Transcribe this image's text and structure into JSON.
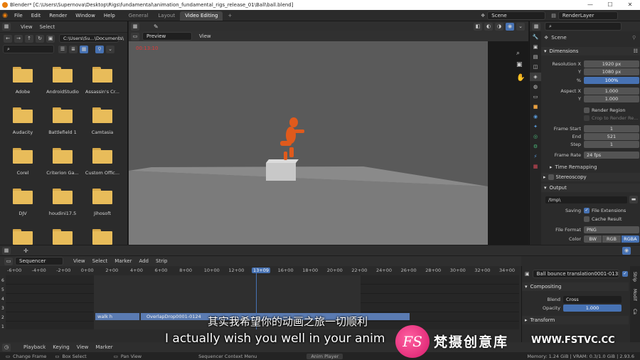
{
  "titlebar": {
    "title": "Blender* [C:\\Users\\Supernova\\Desktop\\Rigs\\fundamental\\animation_fundamental_rigs_release_01\\Ball\\ball.blend]",
    "min": "—",
    "max": "☐",
    "close": "✕"
  },
  "topmenu": {
    "items": [
      "File",
      "Edit",
      "Render",
      "Window",
      "Help"
    ],
    "workspaces": [
      "General",
      "Layout",
      "Video Editing",
      "+"
    ],
    "scene": "Scene",
    "view_layer": "RenderLayer"
  },
  "filebrowser": {
    "menu": [
      "View",
      "Select"
    ],
    "path": "C:\\Users\\Su...\\Documents\\",
    "folders": [
      "Adobe",
      "AndroidStudio",
      "Assassin's Cr...",
      "Audacity",
      "Battlefield 1",
      "Camtasia",
      "Corel",
      "Criterion Ga...",
      "Custom Offic...",
      "DJV",
      "houdini17.5",
      "Jihosoft",
      "",
      "",
      ""
    ]
  },
  "viewport": {
    "mode": "Preview",
    "menu": "View",
    "timecode": "00:13:10"
  },
  "properties": {
    "scene_label": "Scene",
    "dimensions": "Dimensions",
    "res_x_label": "Resolution X",
    "res_x": "1920 px",
    "res_y_label": "Y",
    "res_y": "1080 px",
    "pct_label": "%",
    "pct": "100%",
    "aspect_x_label": "Aspect X",
    "aspect_x": "1.000",
    "aspect_y_label": "Y",
    "aspect_y": "1.000",
    "render_region": "Render Region",
    "crop_region": "Crop to Render Re...",
    "frame_start_label": "Frame Start",
    "frame_start": "1",
    "end_label": "End",
    "end": "521",
    "step_label": "Step",
    "step": "1",
    "frame_rate_label": "Frame Rate",
    "frame_rate": "24 fps",
    "time_remapping": "Time Remapping",
    "stereoscopy": "Stereoscopy",
    "output": "Output",
    "output_path": "/tmp\\",
    "saving_label": "Saving",
    "file_extensions": "File Extensions",
    "cache_result": "Cache Result",
    "file_format_label": "File Format",
    "file_format": "PNG",
    "color_label": "Color",
    "color_opts": [
      "BW",
      "RGB",
      "RGBA"
    ]
  },
  "sequencer": {
    "editor": "Sequencer",
    "menu": [
      "View",
      "Select",
      "Marker",
      "Add",
      "Strip"
    ],
    "ticks": [
      "-6+00",
      "-4+00",
      "-2+00",
      "0+00",
      "2+00",
      "4+00",
      "6+00",
      "8+00",
      "10+00",
      "12+00",
      "13+09",
      "16+00",
      "18+00",
      "20+00",
      "22+00",
      "24+00",
      "26+00",
      "28+00",
      "30+00",
      "32+00",
      "34+00"
    ],
    "channels": [
      "6",
      "5",
      "4",
      "3",
      "2",
      "1"
    ],
    "strips": [
      "walk h",
      "OverlapDrop0001-0124"
    ],
    "side": {
      "strip_name": "Ball bounce translation0001-0135...",
      "compositing": "Compositing",
      "blend_label": "Blend",
      "blend": "Cross",
      "opacity_label": "Opacity",
      "opacity": "1.000",
      "transform": "Transform"
    },
    "side_tabs": [
      "Strip",
      "Modif",
      "Ca"
    ]
  },
  "playback_bar": [
    "Playback",
    "Keying",
    "View",
    "Marker"
  ],
  "statusbar": {
    "items": [
      "Change Frame",
      "Box Select",
      "Pan View",
      "Sequencer Context Menu",
      "Anim Player"
    ],
    "memory": "Memory: 1.24 GiB | VRAM: 0.3/1.0 GiB | 2.93.6"
  },
  "subtitles": {
    "cn": "其实我希望你的动画之旅一切顺利",
    "en": "I actually wish you well in your anim"
  },
  "watermark": {
    "logo_text": "FS",
    "cn": "梵摄创意库",
    "url": "WWW.FSTVC.CC"
  },
  "colors": {
    "accent_blue": "#4772b3",
    "folder": "#e8bc5a",
    "character": "#e05a1c",
    "playhead": "#4772b3"
  }
}
